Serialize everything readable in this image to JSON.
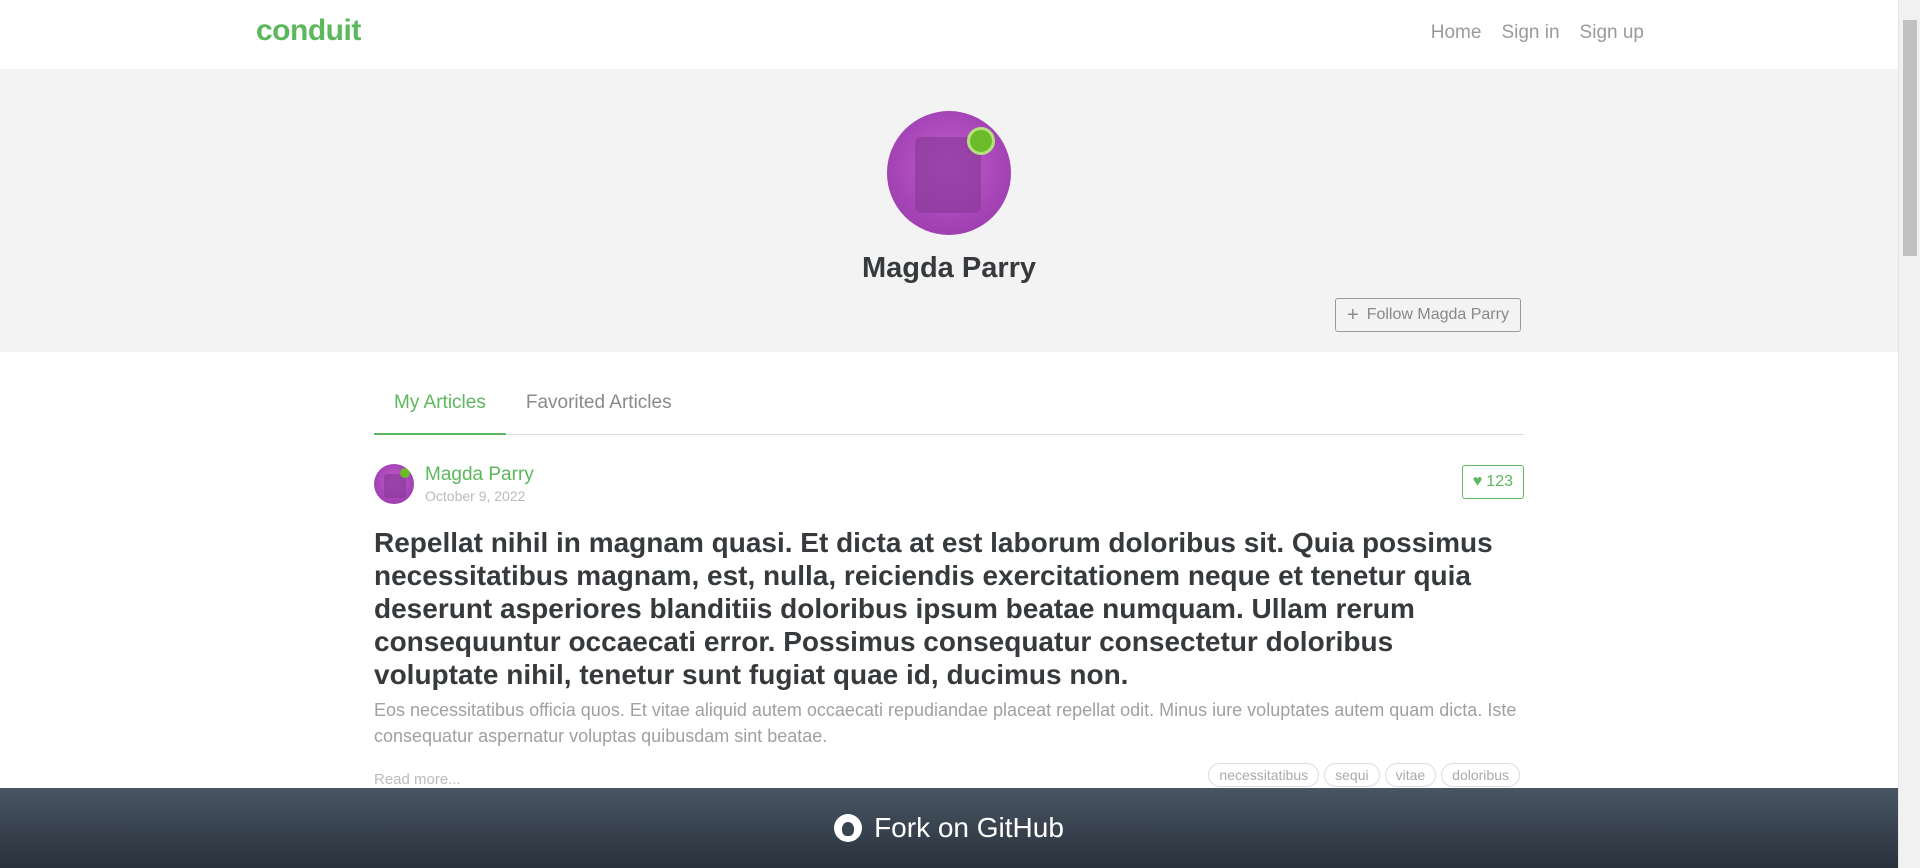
{
  "navbar": {
    "brand": "conduit",
    "links": [
      "Home",
      "Sign in",
      "Sign up"
    ]
  },
  "profile": {
    "name": "Magda Parry",
    "follow_label": "Follow Magda Parry",
    "follow_icon": "plus-icon"
  },
  "tabs": [
    {
      "label": "My Articles",
      "active": true
    },
    {
      "label": "Favorited Articles",
      "active": false
    }
  ],
  "article": {
    "author": "Magda Parry",
    "date": "October 9, 2022",
    "favorites": "123",
    "title": "Repellat nihil in magnam quasi. Et dicta at est laborum doloribus sit. Quia possimus necessitatibus magnam, est, nulla, reiciendis exercitationem neque et tenetur quia deserunt asperiores blanditiis doloribus ipsum beatae numquam. Ullam rerum consequuntur occaecati error. Possimus consequatur consectetur doloribus voluptate nihil, tenetur sunt fugiat quae id, ducimus non.",
    "description": "Eos necessitatibus officia quos. Et vitae aliquid autem occaecati repudiandae placeat repellat odit. Minus iure voluptates autem quam dicta. Iste consequatur aspernatur voluptas quibusdam sint beatae.",
    "read_more": "Read more...",
    "tags": [
      "necessitatibus",
      "sequi",
      "vitae",
      "doloribus"
    ]
  },
  "footer": {
    "label": "Fork on GitHub"
  },
  "colors": {
    "brand": "#5cb85c",
    "banner": "#f3f3f3",
    "footer": "#3a4450"
  }
}
